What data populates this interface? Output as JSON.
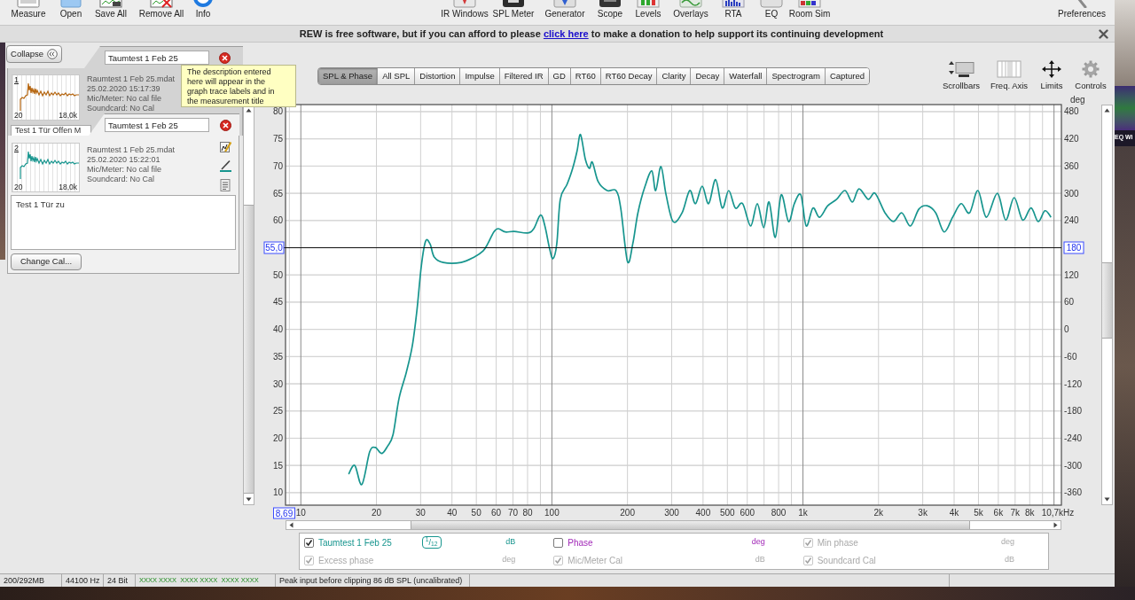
{
  "toolbar": {
    "left": [
      {
        "label": "Measure"
      },
      {
        "label": "Open"
      },
      {
        "label": "Save All"
      },
      {
        "label": "Remove All"
      },
      {
        "label": "Info"
      }
    ],
    "center": [
      {
        "label": "IR Windows"
      },
      {
        "label": "SPL Meter"
      },
      {
        "label": "Generator"
      },
      {
        "label": "Scope"
      },
      {
        "label": "Levels"
      },
      {
        "label": "Overlays"
      },
      {
        "label": "RTA"
      },
      {
        "label": "EQ"
      },
      {
        "label": "Room Sim"
      }
    ],
    "right": [
      {
        "label": "Preferences"
      }
    ]
  },
  "banner": {
    "text_before": "REW is free software, but if you can afford to please ",
    "link": "click here",
    "text_after": " to make a donation to help support its continuing development"
  },
  "measurements_panel": {
    "collapse_button": "Collapse",
    "measurements": [
      {
        "number": "1",
        "title": "Taumtest 1 Feb 25",
        "file": "Raumtest 1 Feb 25.mdat",
        "timestamp": "25.02.2020 15:17:39",
        "mic_cal": "Mic/Meter: No cal file",
        "soundcard_cal": "Soundcard: No Cal",
        "notes": "Test 1 Tür Offen M",
        "axis_min": "20",
        "axis_max": "18,0k",
        "color": "#b5650f",
        "selected": false
      },
      {
        "number": "2",
        "title": "Taumtest 1 Feb 25",
        "file": "Raumtest 1 Feb 25.mdat",
        "timestamp": "25.02.2020 15:22:01",
        "mic_cal": "Mic/Meter: No cal file",
        "soundcard_cal": "Soundcard: No Cal",
        "notes": "Test 1 Tür zu",
        "axis_min": "20",
        "axis_max": "18,0k",
        "color": "#17958e",
        "selected": true,
        "change_cal_button": "Change Cal..."
      }
    ]
  },
  "tooltip": "The description entered here will appear in the graph trace labels and in the measurement title",
  "graph_tabs": [
    {
      "label": "SPL & Phase",
      "selected": true
    },
    {
      "label": "All SPL",
      "selected": false
    },
    {
      "label": "Distortion",
      "selected": false
    },
    {
      "label": "Impulse",
      "selected": false
    },
    {
      "label": "Filtered IR",
      "selected": false
    },
    {
      "label": "GD",
      "selected": false
    },
    {
      "label": "RT60",
      "selected": false
    },
    {
      "label": "RT60 Decay",
      "selected": false
    },
    {
      "label": "Clarity",
      "selected": false
    },
    {
      "label": "Decay",
      "selected": false
    },
    {
      "label": "Waterfall",
      "selected": false
    },
    {
      "label": "Spectrogram",
      "selected": false
    },
    {
      "label": "Captured",
      "selected": false
    }
  ],
  "graph_tools": [
    {
      "label": "Scrollbars"
    },
    {
      "label": "Freq. Axis"
    },
    {
      "label": "Limits"
    },
    {
      "label": "Controls"
    }
  ],
  "graph": {
    "chart_data": {
      "type": "line",
      "log": "x",
      "grid": true,
      "x": [
        15.5,
        16.4,
        17.5,
        18.8,
        19.8,
        21,
        22.2,
        23.3,
        24.6,
        26.3,
        27.8,
        29,
        30.2,
        31.4,
        32.7,
        34,
        36.9,
        43.5,
        49.1,
        53.2,
        55.5,
        58.7,
        61.2,
        65.2,
        70.7,
        80,
        84.7,
        90.1,
        93.8,
        97.8,
        101,
        104.6,
        108,
        115,
        121,
        126,
        130,
        136,
        141,
        145,
        153,
        166,
        180,
        188,
        200,
        210,
        220,
        235,
        250,
        259,
        272,
        285,
        304,
        330,
        354,
        373,
        397,
        421,
        449,
        477,
        506,
        538,
        575,
        619,
        658,
        698,
        733,
        776,
        819,
        876,
        924,
        981,
        1030,
        1096,
        1164,
        1255,
        1362,
        1471,
        1574,
        1671,
        1821,
        1938,
        2123,
        2294,
        2478,
        2678,
        2895,
        3121,
        3380,
        3650,
        3946,
        4264,
        4606,
        4977,
        5377,
        5947,
        6420,
        6937,
        7500,
        8100,
        8650,
        9200,
        9730
      ],
      "series": [
        {
          "color": "#17958e",
          "values": [
            13.4,
            15.0,
            11.5,
            17.5,
            18.3,
            17.2,
            18.6,
            20.7,
            27.3,
            32.1,
            37.0,
            43.5,
            51.7,
            56.2,
            55.7,
            53.3,
            52.3,
            52.3,
            53.3,
            54.4,
            55.7,
            57.9,
            58.5,
            57.9,
            58.0,
            57.7,
            58.5,
            61.0,
            59.0,
            54.9,
            53.0,
            55.7,
            63.9,
            66.7,
            69.6,
            72.8,
            75.8,
            71.2,
            69.6,
            70.7,
            67.1,
            65.5,
            65.5,
            62.3,
            52.5,
            55.7,
            61.4,
            66.3,
            69.1,
            65.5,
            69.9,
            64.7,
            59.8,
            61.4,
            65.5,
            63.1,
            66.3,
            63.1,
            67.5,
            62.3,
            65.5,
            62.3,
            63.1,
            59.0,
            63.1,
            58.7,
            63.4,
            56.9,
            64.7,
            59.8,
            63.1,
            64.7,
            59.0,
            62.3,
            60.6,
            62.7,
            63.9,
            65.5,
            63.4,
            65.8,
            63.9,
            65.0,
            61.4,
            59.8,
            61.4,
            59.0,
            62.1,
            62.7,
            61.4,
            57.9,
            60.6,
            63.1,
            61.4,
            65.5,
            60.6,
            65.0,
            60.1,
            64.2,
            60.1,
            62.3,
            59.8,
            61.8,
            60.6
          ]
        }
      ],
      "xlim": [
        8.69,
        10700
      ],
      "ylim": [
        7.7,
        81.3
      ],
      "xticks": [
        10,
        20,
        30,
        40,
        50,
        60,
        70,
        80,
        100,
        200,
        300,
        400,
        500,
        600,
        800,
        {
          "value": 1000,
          "label": "1k"
        },
        {
          "value": 2000,
          "label": "2k"
        },
        {
          "value": 3000,
          "label": "3k"
        },
        {
          "value": 4000,
          "label": "4k"
        },
        {
          "value": 5000,
          "label": "5k"
        },
        {
          "value": 6000,
          "label": "6k"
        },
        {
          "value": 7000,
          "label": "7k"
        },
        {
          "value": 8000,
          "label": "8k"
        }
      ],
      "yticks": [
        80,
        75,
        70,
        65,
        60,
        50,
        45,
        40,
        35,
        30,
        25,
        20,
        15,
        10
      ],
      "y2label": "deg",
      "y2lim": [
        -387.6,
        495.6
      ],
      "y2ticks": [
        480,
        420,
        360,
        300,
        240,
        120,
        60,
        0,
        -60,
        -120,
        -180,
        -240,
        -300,
        -360
      ],
      "ref_lines": [
        {
          "axis": "y",
          "value": 55,
          "label": "55,0"
        }
      ]
    },
    "phase_cursor_readout": "180",
    "axis_start_readout": "8,69",
    "axis_end_readout": "10,7kHz"
  },
  "legend": [
    {
      "label": "Taumtest 1 Feb 25",
      "checked": true,
      "disabled": false,
      "color": "#17958e",
      "smoothing": "$^{1}$/$_{12}$",
      "unit": "dB"
    },
    {
      "label": "Phase",
      "checked": false,
      "disabled": false,
      "color": "#a22ab8",
      "unit": "deg"
    },
    {
      "label": "Min phase",
      "checked": true,
      "disabled": true,
      "unit": "deg"
    },
    {
      "label": "Excess phase",
      "checked": true,
      "disabled": true,
      "unit": "deg"
    },
    {
      "label": "Mic/Meter Cal",
      "checked": true,
      "disabled": true,
      "unit": "dB"
    },
    {
      "label": "Soundcard Cal",
      "checked": true,
      "disabled": true,
      "unit": "dB"
    }
  ],
  "status_bar": [
    {
      "text": "200/292MB"
    },
    {
      "text": "44100 Hz"
    },
    {
      "text": "24 Bit"
    },
    {
      "text": "XXXX XXXX  XXXX XXXX  XXXX XXXX",
      "color": "#1c8a1c"
    },
    {
      "text": "Peak input before clipping 86 dB SPL (uncalibrated)"
    }
  ],
  "background_window": {
    "label": "EQ Wi"
  }
}
